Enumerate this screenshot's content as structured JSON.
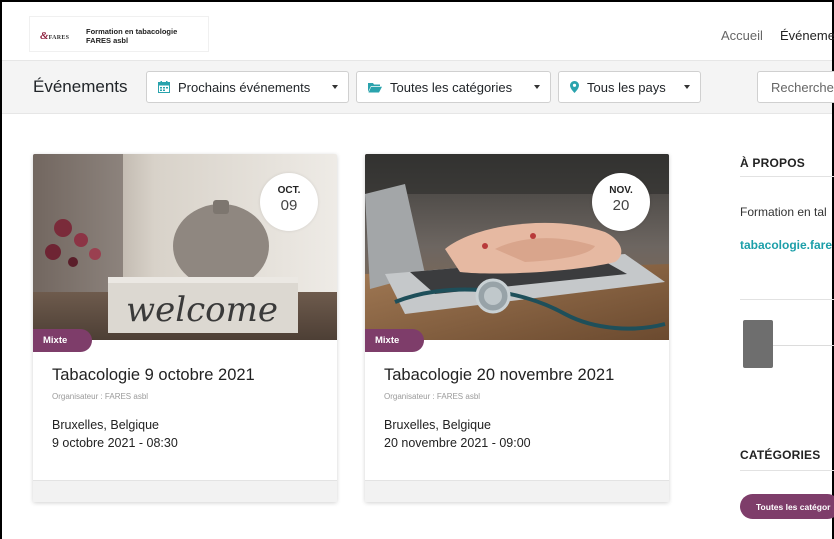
{
  "header": {
    "logo_mark": "&",
    "logo_mark_sub": "FARES",
    "logo_line1": "Formation en tabacologie",
    "logo_line2": "FARES asbl",
    "nav": [
      "Accueil",
      "Événements"
    ]
  },
  "toolbar": {
    "title": "Événements",
    "date_filter": "Prochains événements",
    "category_filter": "Toutes les catégories",
    "country_filter": "Tous les pays",
    "search_placeholder": "Recherche..."
  },
  "events": [
    {
      "month": "OCT.",
      "day": "09",
      "tag": "Mixte",
      "title": "Tabacologie 9 octobre 2021",
      "organizer": "Organisateur : FARES asbl",
      "location": "Bruxelles, Belgique",
      "datetime": "9 octobre 2021 - 08:30",
      "image_text": "welcome",
      "image": "welcome-sign-photo"
    },
    {
      "month": "NOV.",
      "day": "20",
      "tag": "Mixte",
      "title": "Tabacologie 20 novembre 2021",
      "organizer": "Organisateur : FARES asbl",
      "location": "Bruxelles, Belgique",
      "datetime": "20 novembre 2021 - 09:00",
      "image": "laptop-stethoscope-photo"
    }
  ],
  "sidebar": {
    "about_heading": "À PROPOS",
    "about_text": "Formation en tal",
    "about_link": "tabacologie.fare",
    "categories_heading": "CATÉGORIES",
    "categories_pill": "Toutes les catégor"
  },
  "colors": {
    "accent": "#7e3d6a",
    "link": "#1c9fa9",
    "toolbar_bg": "#f4f4f4"
  },
  "icons": [
    "calendar-icon",
    "folder-open-icon",
    "map-marker-icon",
    "chevron-down-icon"
  ]
}
